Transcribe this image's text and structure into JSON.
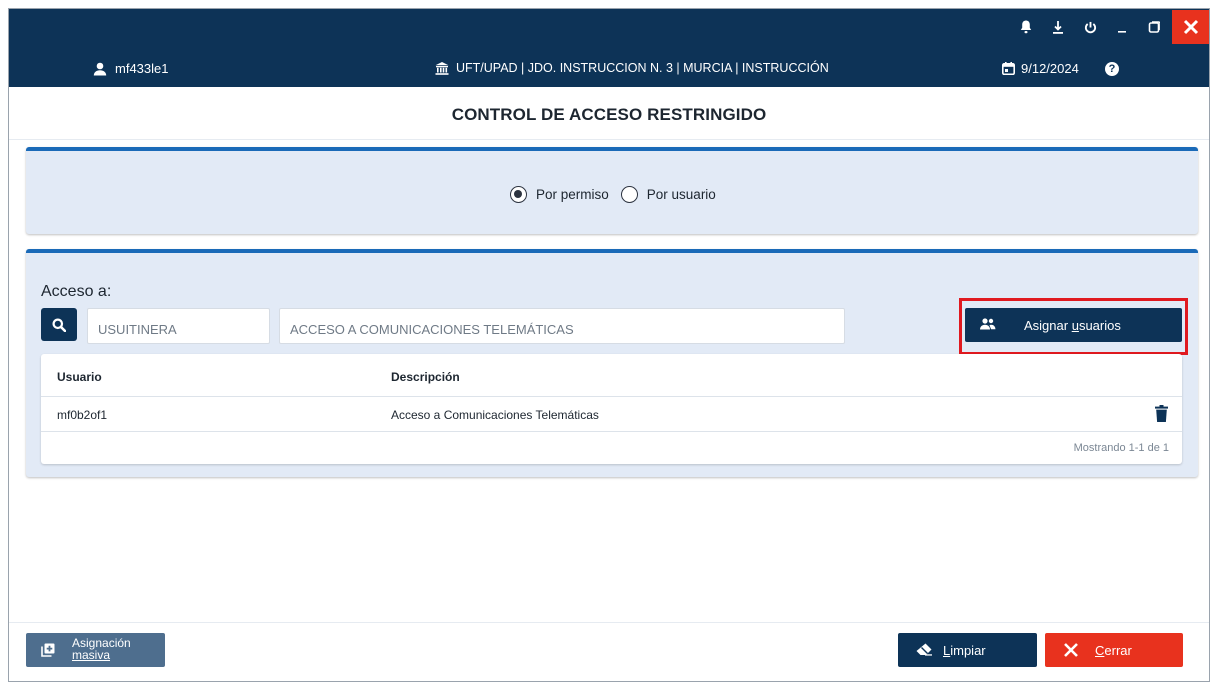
{
  "header": {
    "user": "mf433le1",
    "court": "UFT/UPAD | JDO. INSTRUCCION N. 3 | MURCIA | INSTRUCCIÓN",
    "date": "9/12/2024",
    "help": "?"
  },
  "window_controls": [
    "bell-icon",
    "download-icon",
    "power-icon",
    "minimize-icon",
    "restore-icon",
    "close-icon"
  ],
  "page": {
    "title": "CONTROL DE ACCESO RESTRINGIDO"
  },
  "mode": {
    "options": [
      {
        "label": "Por permiso",
        "selected": true
      },
      {
        "label": "Por usuario",
        "selected": false
      }
    ]
  },
  "access": {
    "label": "Acceso a:",
    "code_value": "USUITINERA",
    "description_value": "ACCESO A COMUNICACIONES TELEMÁTICAS",
    "assign_button": {
      "prefix": "Asignar ",
      "underlined": "u",
      "rest": "suarios"
    }
  },
  "table": {
    "columns": [
      "Usuario",
      "Descripción"
    ],
    "rows": [
      {
        "usuario": "mf0b2of1",
        "descripcion": "Acceso a Comunicaciones Telemáticas"
      }
    ],
    "pagination": "Mostrando 1-1 de 1"
  },
  "footer": {
    "mass_assign": {
      "line1": "Asignación",
      "line2": "masiva"
    },
    "clear": {
      "underlined": "L",
      "rest": "impiar"
    },
    "close": {
      "underlined": "C",
      "rest": "errar"
    }
  },
  "colors": {
    "navy": "#0d3357",
    "accent_blue": "#1a6ab8",
    "panel_bg": "#e2eaf6",
    "danger": "#e8321e",
    "highlight": "#e0191f",
    "mass_button": "#4e6e8e"
  }
}
